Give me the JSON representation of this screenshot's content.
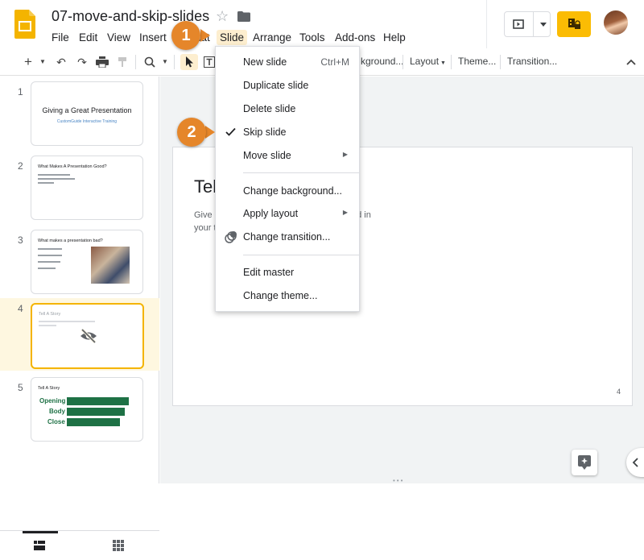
{
  "header": {
    "title": "07-move-and-skip-slides",
    "menus": [
      "File",
      "Edit",
      "View",
      "Insert",
      "Format",
      "Slide",
      "Arrange",
      "Tools",
      "Add-ons",
      "Help"
    ],
    "active_menu": "Slide",
    "star_icon": "star-outline-icon",
    "folder_icon": "folder-icon",
    "present_icon": "present-icon",
    "share_icon": "share-lock-icon",
    "brand_color": "#fbbc04"
  },
  "toolbar": {
    "background_label": "kground...",
    "layout_label": "Layout",
    "theme_label": "Theme...",
    "transition_label": "Transition..."
  },
  "filmstrip": {
    "slides": [
      {
        "number": "1",
        "title": "Giving a Great Presentation",
        "subtitle": "CustomGuide Interactive Training"
      },
      {
        "number": "2",
        "title": "What Makes A Presentation Good?"
      },
      {
        "number": "3",
        "title": "What makes a presentation bad?"
      },
      {
        "number": "4",
        "title": "Tell A Story",
        "skipped_icon": "eye-slash-icon"
      },
      {
        "number": "5",
        "title": "Tell A Story",
        "rows": [
          "Opening",
          "Body",
          "Close"
        ]
      }
    ]
  },
  "slide": {
    "title": "Tel",
    "body_line1": "Give",
    "body_line2": "your t",
    "body_tail": "ed in",
    "number": "4"
  },
  "slide_menu": {
    "items": [
      {
        "label": "New slide",
        "shortcut": "Ctrl+M"
      },
      {
        "label": "Duplicate slide"
      },
      {
        "label": "Delete slide"
      },
      {
        "label": "Skip slide",
        "checked": true
      },
      {
        "label": "Move slide",
        "submenu": true
      },
      {
        "label": "Change background..."
      },
      {
        "label": "Apply layout",
        "submenu": true
      },
      {
        "label": "Change transition..."
      },
      {
        "label": "Edit master"
      },
      {
        "label": "Change theme..."
      }
    ]
  },
  "callouts": {
    "step1": "1",
    "step2": "2",
    "color": "#e5862a"
  }
}
